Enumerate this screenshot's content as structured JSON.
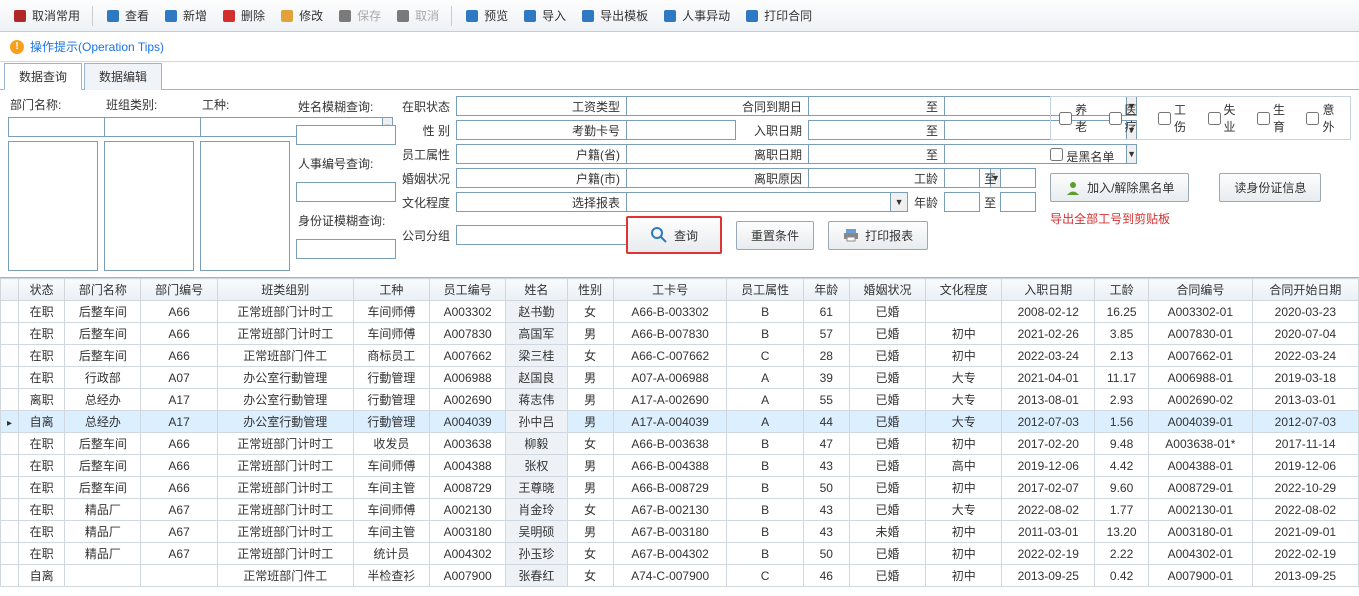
{
  "toolbar": [
    {
      "id": "cancel-common",
      "label": "取消常用",
      "iconColor": "#b02828"
    },
    {
      "id": "view",
      "label": "查看",
      "iconColor": "#2f78c2"
    },
    {
      "id": "add",
      "label": "新增",
      "iconColor": "#2f78c2"
    },
    {
      "id": "delete",
      "label": "删除",
      "iconColor": "#d32f2f"
    },
    {
      "id": "edit",
      "label": "修改",
      "iconColor": "#e2a23b"
    },
    {
      "id": "save",
      "label": "保存",
      "iconColor": "#7a7a7a",
      "disabled": true
    },
    {
      "id": "undo",
      "label": "取消",
      "iconColor": "#7a7a7a",
      "disabled": true
    },
    {
      "id": "preview",
      "label": "预览",
      "iconColor": "#2f78c2"
    },
    {
      "id": "import",
      "label": "导入",
      "iconColor": "#2f78c2"
    },
    {
      "id": "export-tpl",
      "label": "导出模板",
      "iconColor": "#2f78c2"
    },
    {
      "id": "hr-change",
      "label": "人事异动",
      "iconColor": "#2f78c2"
    },
    {
      "id": "print-contract",
      "label": "打印合同",
      "iconColor": "#2f78c2"
    }
  ],
  "tips": "操作提示(Operation Tips)",
  "tabs": [
    {
      "id": "data-query",
      "label": "数据查询",
      "active": true
    },
    {
      "id": "data-edit",
      "label": "数据编辑"
    }
  ],
  "filters": {
    "dept_label": "部门名称:",
    "team_label": "班组类别:",
    "jobtype_label": "工种:",
    "name_fuzzy": "姓名模糊查询:",
    "emp_no": "人事编号查询:",
    "id_fuzzy": "身份证模糊查询:",
    "status": "在职状态",
    "salary_type": "工资类型",
    "contract_end": "合同到期日",
    "to": "至",
    "gender": "性    别",
    "attend_card": "考勤卡号",
    "entry_date": "入职日期",
    "emp_attr": "员工属性",
    "province": "户籍(省)",
    "leave_date": "离职日期",
    "marital": "婚姻状况",
    "city": "户籍(市)",
    "leave_reason": "离职原因",
    "seniority": "工龄",
    "edu": "文化程度",
    "select_report": "选择报表",
    "age": "年龄",
    "company_group": "公司分组",
    "query_btn": "查询",
    "reset_btn": "重置条件",
    "print_report": "打印报表",
    "chk_pension": "养老",
    "chk_medical": "医疗",
    "chk_injury": "工伤",
    "chk_unemploy": "失业",
    "chk_birth": "生育",
    "chk_accident": "意外",
    "chk_blacklist": "是黑名单",
    "add_blacklist": "加入/解除黑名单",
    "read_id": "读身份证信息",
    "export_all": "导出全部工号到剪贴板"
  },
  "columns": [
    "",
    "状态",
    "部门名称",
    "部门编号",
    "班类组别",
    "工种",
    "员工编号",
    "姓名",
    "性别",
    "工卡号",
    "员工属性",
    "年龄",
    "婚姻状况",
    "文化程度",
    "入职日期",
    "工龄",
    "合同编号",
    "合同开始日期"
  ],
  "rows": [
    {
      "status": "在职",
      "dept": "后整车间",
      "deptno": "A66",
      "team": "正常班部门计时工",
      "job": "车间师傅",
      "empno": "A003302",
      "name": "赵书勤",
      "gender": "女",
      "card": "A66-B-003302",
      "attr": "B",
      "age": "61",
      "marital": "已婚",
      "edu": "",
      "entry": "2008-02-12",
      "sen": "16.25",
      "contract": "A003302-01",
      "cstart": "2020-03-23"
    },
    {
      "status": "在职",
      "dept": "后整车间",
      "deptno": "A66",
      "team": "正常班部门计时工",
      "job": "车间师傅",
      "empno": "A007830",
      "name": "高国军",
      "gender": "男",
      "card": "A66-B-007830",
      "attr": "B",
      "age": "57",
      "marital": "已婚",
      "edu": "初中",
      "entry": "2021-02-26",
      "sen": "3.85",
      "contract": "A007830-01",
      "cstart": "2020-07-04"
    },
    {
      "status": "在职",
      "dept": "后整车间",
      "deptno": "A66",
      "team": "正常班部门件工",
      "job": "商标员工",
      "empno": "A007662",
      "name": "梁三桂",
      "gender": "女",
      "card": "A66-C-007662",
      "attr": "C",
      "age": "28",
      "marital": "已婚",
      "edu": "初中",
      "entry": "2022-03-24",
      "sen": "2.13",
      "contract": "A007662-01",
      "cstart": "2022-03-24"
    },
    {
      "status": "在职",
      "dept": "行政部",
      "deptno": "A07",
      "team": "办公室行動管理",
      "job": "行動管理",
      "empno": "A006988",
      "name": "赵国良",
      "gender": "男",
      "card": "A07-A-006988",
      "attr": "A",
      "age": "39",
      "marital": "已婚",
      "edu": "大专",
      "entry": "2021-04-01",
      "sen": "11.17",
      "contract": "A006988-01",
      "cstart": "2019-03-18"
    },
    {
      "status": "离职",
      "dept": "总经办",
      "deptno": "A17",
      "team": "办公室行動管理",
      "job": "行動管理",
      "empno": "A002690",
      "name": "蒋志伟",
      "gender": "男",
      "card": "A17-A-002690",
      "attr": "A",
      "age": "55",
      "marital": "已婚",
      "edu": "大专",
      "entry": "2013-08-01",
      "sen": "2.93",
      "contract": "A002690-02",
      "cstart": "2013-03-01"
    },
    {
      "status": "自离",
      "dept": "总经办",
      "deptno": "A17",
      "team": "办公室行動管理",
      "job": "行動管理",
      "empno": "A004039",
      "name": "孙中吕",
      "gender": "男",
      "card": "A17-A-004039",
      "attr": "A",
      "age": "44",
      "marital": "已婚",
      "edu": "大专",
      "entry": "2012-07-03",
      "sen": "1.56",
      "contract": "A004039-01",
      "cstart": "2012-07-03",
      "selected": true
    },
    {
      "status": "在职",
      "dept": "后整车间",
      "deptno": "A66",
      "team": "正常班部门计时工",
      "job": "收发员",
      "empno": "A003638",
      "name": "柳毅",
      "gender": "女",
      "card": "A66-B-003638",
      "attr": "B",
      "age": "47",
      "marital": "已婚",
      "edu": "初中",
      "entry": "2017-02-20",
      "sen": "9.48",
      "contract": "A003638-01*",
      "cstart": "2017-11-14"
    },
    {
      "status": "在职",
      "dept": "后整车间",
      "deptno": "A66",
      "team": "正常班部门计时工",
      "job": "车间师傅",
      "empno": "A004388",
      "name": "张权",
      "gender": "男",
      "card": "A66-B-004388",
      "attr": "B",
      "age": "43",
      "marital": "已婚",
      "edu": "高中",
      "entry": "2019-12-06",
      "sen": "4.42",
      "contract": "A004388-01",
      "cstart": "2019-12-06"
    },
    {
      "status": "在职",
      "dept": "后整车间",
      "deptno": "A66",
      "team": "正常班部门计时工",
      "job": "车间主管",
      "empno": "A008729",
      "name": "王尊晓",
      "gender": "男",
      "card": "A66-B-008729",
      "attr": "B",
      "age": "50",
      "marital": "已婚",
      "edu": "初中",
      "entry": "2017-02-07",
      "sen": "9.60",
      "contract": "A008729-01",
      "cstart": "2022-10-29"
    },
    {
      "status": "在职",
      "dept": "精品厂",
      "deptno": "A67",
      "team": "正常班部门计时工",
      "job": "车间师傅",
      "empno": "A002130",
      "name": "肖金玲",
      "gender": "女",
      "card": "A67-B-002130",
      "attr": "B",
      "age": "43",
      "marital": "已婚",
      "edu": "大专",
      "entry": "2022-08-02",
      "sen": "1.77",
      "contract": "A002130-01",
      "cstart": "2022-08-02"
    },
    {
      "status": "在职",
      "dept": "精品厂",
      "deptno": "A67",
      "team": "正常班部门计时工",
      "job": "车间主管",
      "empno": "A003180",
      "name": "吴明硕",
      "gender": "男",
      "card": "A67-B-003180",
      "attr": "B",
      "age": "43",
      "marital": "未婚",
      "edu": "初中",
      "entry": "2011-03-01",
      "sen": "13.20",
      "contract": "A003180-01",
      "cstart": "2021-09-01"
    },
    {
      "status": "在职",
      "dept": "精品厂",
      "deptno": "A67",
      "team": "正常班部门计时工",
      "job": "统计员",
      "empno": "A004302",
      "name": "孙玉珍",
      "gender": "女",
      "card": "A67-B-004302",
      "attr": "B",
      "age": "50",
      "marital": "已婚",
      "edu": "初中",
      "entry": "2022-02-19",
      "sen": "2.22",
      "contract": "A004302-01",
      "cstart": "2022-02-19"
    },
    {
      "status": "自离",
      "dept": "",
      "deptno": "",
      "team": "正常班部门件工",
      "job": "半检查衫",
      "empno": "A007900",
      "name": "张春红",
      "gender": "女",
      "card": "A74-C-007900",
      "attr": "C",
      "age": "46",
      "marital": "已婚",
      "edu": "初中",
      "entry": "2013-09-25",
      "sen": "0.42",
      "contract": "A007900-01",
      "cstart": "2013-09-25"
    }
  ]
}
